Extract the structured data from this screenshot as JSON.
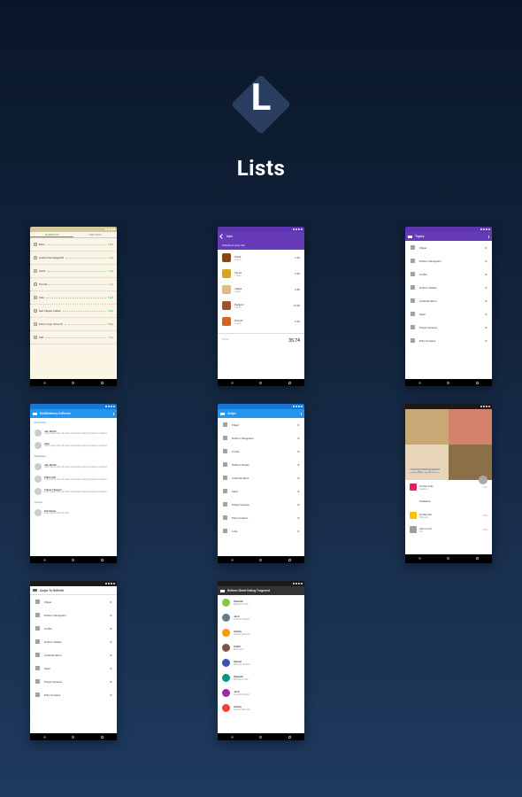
{
  "hero": {
    "logo_letter": "L",
    "title": "Lists"
  },
  "s1": {
    "tab1": "INGREDIENTS",
    "tab2": "DIRECTIONS",
    "rows": [
      {
        "n": "Basil",
        "a": "6 leaf"
      },
      {
        "n": "Gluten-free Spaghetti",
        "a": "2 cup"
      },
      {
        "n": "Garlic",
        "a": "2 cup"
      },
      {
        "n": "Ricotta",
        "a": "1 cup"
      },
      {
        "n": "Kale",
        "a": "3 leaf"
      },
      {
        "n": "Red Pepper Flakes",
        "a": "1 tbsp"
      },
      {
        "n": "Extra Virgin Olive Oil",
        "a": "2 tbsp"
      },
      {
        "n": "Salt",
        "a": "1 tsp"
      }
    ]
  },
  "s2": {
    "title": "Cart",
    "sub": "5 Items in your cart",
    "items": [
      {
        "n": "Pizza",
        "q": "2 each",
        "p": "2.20",
        "c": "#8b4513"
      },
      {
        "n": "Tacos",
        "q": "1 plate",
        "p": "3.40",
        "c": "#daa520"
      },
      {
        "n": "Cakes",
        "q": "4 each",
        "p": "6.80",
        "c": "#deb887"
      },
      {
        "n": "Burgers",
        "q": "2 each",
        "p": "12.00",
        "c": "#a0522d"
      },
      {
        "n": "Donuts",
        "q": "6 each",
        "p": "5.20",
        "c": "#d2691e"
      }
    ],
    "total_l": "TOTAL",
    "total_v": "35.74"
  },
  "s3": {
    "title": "Topics",
    "rows": [
      "Player",
      "Bottom Navigation",
      "Profile",
      "Bottom Sheets",
      "Authentication",
      "Feed",
      "Empty Screens",
      "Entry Screens"
    ]
  },
  "s4": {
    "title": "Notifications Collector",
    "sec1": "Favourites",
    "sec2": "Messages",
    "sec3": "Groups",
    "rows": [
      {
        "n": "Jen Smith",
        "t": "Lorem ipsum dolor sit amet, consectetur adipiscing tempor incididunt"
      },
      {
        "n": "Alex",
        "t": "Lorem ipsum dolor sit amet, consectetur adipiscing tempor incididunt"
      },
      {
        "n": "Jen Smith",
        "t": "Lorem ipsum dolor sit amet, consectetur adipiscing tempor incididunt"
      },
      {
        "n": "Erika Holt",
        "t": "Lorem ipsum dolor sit amet, consectetur adipiscing tempor incididunt"
      },
      {
        "n": "Trevor Hansen",
        "t": "Lorem ipsum dolor sit amet, consectetur adipiscing tempor incididunt"
      },
      {
        "n": "Kurt Drew",
        "t": "Lorem ipsum dolor sit amet"
      }
    ]
  },
  "s5": {
    "title": "Swipe",
    "rows": [
      "Player",
      "Bottom Navigation",
      "Profile",
      "Bottom Sheets",
      "Authentication",
      "Feed",
      "Empty Screens",
      "Entry Screens",
      "Lists"
    ]
  },
  "s6": {
    "title": "Most Played Songs",
    "rows": [
      {
        "n": "On the rocks",
        "a": "Freelance",
        "p": "3:27",
        "c": "#e91e63"
      },
      {
        "n": "Freelance",
        "a": "",
        "p": "",
        "c": "#fff"
      },
      {
        "n": "On the One",
        "a": "Wild cubs",
        "p": "5:07",
        "c": "#ffc107"
      },
      {
        "n": "Life is a Vit",
        "a": "Zoo",
        "p": "3:42",
        "c": "#9e9e9e"
      }
    ]
  },
  "s7": {
    "title": "Swipe To Refresh",
    "rows": [
      "Player",
      "Bottom Navigation",
      "Profile",
      "Bottom Sheets",
      "Authentication",
      "Feed",
      "Empty Screens",
      "Entry Screens"
    ]
  },
  "s8": {
    "title": "Bottom Sheet Dialog Fragment",
    "rows": [
      {
        "n": "Shaunik",
        "l": "Bengaluru, India",
        "c": "#8bc34a"
      },
      {
        "n": "Jeck",
        "l": "America, England",
        "c": "#607d8b"
      },
      {
        "n": "Ashley",
        "l": "Kolkata, Indonesia",
        "c": "#ff9800"
      },
      {
        "n": "Smith",
        "l": "Bihar, India",
        "c": "#795548"
      },
      {
        "n": "Steven",
        "l": "Newyork, America",
        "c": "#3f51b5"
      },
      {
        "n": "Shaunik",
        "l": "Bengaluru, India",
        "c": "#009688"
      },
      {
        "n": "Jeck",
        "l": "America, England",
        "c": "#9c27b0"
      },
      {
        "n": "Ashley",
        "l": "Kolkata, Indonesia",
        "c": "#f44336"
      }
    ]
  }
}
